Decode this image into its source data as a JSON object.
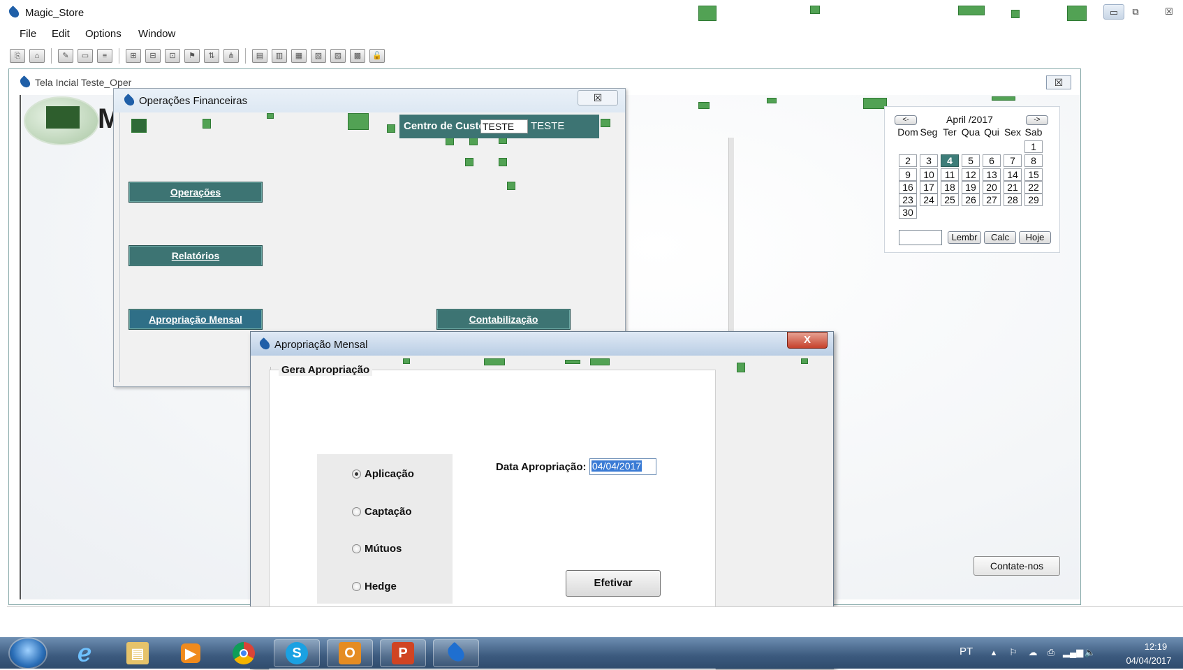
{
  "app": {
    "title": "Magic_Store"
  },
  "window_controls": {
    "minimize": "▭",
    "restore": "⧉",
    "close": "☒"
  },
  "menu": [
    "File",
    "Edit",
    "Options",
    "Window"
  ],
  "mdi_window": {
    "title": "Tela Incial Teste_Oper",
    "close": "☒",
    "logo_letter": "M"
  },
  "calendar": {
    "prev": "<-",
    "next": "->",
    "month_year": "April   /2017",
    "weekdays": [
      "Dom",
      "Seg",
      "Ter",
      "Qua",
      "Qui",
      "Sex",
      "Sab"
    ],
    "days": [
      "1",
      "2",
      "3",
      "4",
      "5",
      "6",
      "7",
      "8",
      "9",
      "10",
      "11",
      "12",
      "13",
      "14",
      "15",
      "16",
      "17",
      "18",
      "19",
      "20",
      "21",
      "22",
      "23",
      "24",
      "25",
      "26",
      "27",
      "28",
      "29",
      "30"
    ],
    "selected_day": "4",
    "buttons": {
      "lembr": "Lembr",
      "calc": "Calc",
      "hoje": "Hoje"
    }
  },
  "contact_button": "Contate-nos",
  "operacoes_financeiras": {
    "title": "Operações Financeiras",
    "close": "☒",
    "centro_custo_label": "Centro de Custo",
    "centro_custo_input": "TESTE",
    "centro_custo_value": "TESTE",
    "buttons": {
      "operacoes": "Operações",
      "relatorios": "Relatórios",
      "apropriacao": "Apropriação Mensal",
      "contabilizacao": "Contabilização"
    }
  },
  "apropriacao_dialog": {
    "title": "Apropriação Mensal",
    "close": "X",
    "group_title": "Gera Apropriação",
    "options": [
      {
        "label": "Aplicação",
        "selected": true
      },
      {
        "label": "Captação",
        "selected": false
      },
      {
        "label": "Mútuos",
        "selected": false
      },
      {
        "label": "Hedge",
        "selected": false
      }
    ],
    "date_label": "Data Apropriação:",
    "date_value": "04/04/2017",
    "submit": "Efetivar"
  },
  "taskbar": {
    "apps": [
      "ie-icon",
      "explorer-icon",
      "media-player-icon",
      "chrome-icon",
      "skype-icon",
      "outlook-icon",
      "powerpoint-icon",
      "magic-icon"
    ],
    "lang": "PT",
    "time": "12:19",
    "date": "04/04/2017"
  }
}
